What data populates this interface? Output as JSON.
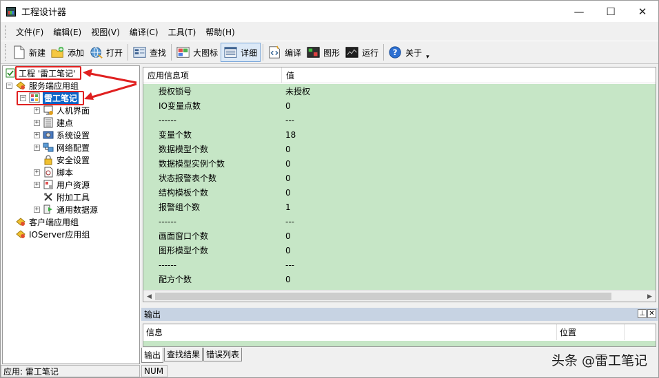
{
  "window": {
    "title": "工程设计器",
    "minimize": "—",
    "maximize": "☐",
    "close": "✕"
  },
  "menu": [
    "文件(F)",
    "编辑(E)",
    "视图(V)",
    "编译(C)",
    "工具(T)",
    "帮助(H)"
  ],
  "toolbar": {
    "new": "新建",
    "add": "添加",
    "open": "打开",
    "find": "查找",
    "large_icon": "大图标",
    "detail": "详细",
    "compile": "编译",
    "graphics": "图形",
    "run": "运行",
    "about": "关于",
    "more": "▾"
  },
  "tree": {
    "root": "工程 '雷工笔记'",
    "server_group": "服务端应用组",
    "app": "雷工笔记",
    "children": [
      "人机界面",
      "建点",
      "系统设置",
      "网络配置",
      "安全设置",
      "脚本",
      "用户资源",
      "附加工具",
      "通用数据源"
    ],
    "client_group": "客户端应用组",
    "ioserver_group": "IOServer应用组",
    "expand": "+",
    "collapse": "−"
  },
  "details": {
    "col1": "应用信息项",
    "col2": "值",
    "rows": [
      [
        "授权锁号",
        "未授权"
      ],
      [
        "IO变量点数",
        "0"
      ],
      [
        "------",
        "---"
      ],
      [
        "变量个数",
        "18"
      ],
      [
        "数据模型个数",
        "0"
      ],
      [
        "数据模型实例个数",
        "0"
      ],
      [
        "状态报警表个数",
        "0"
      ],
      [
        "结构模板个数",
        "0"
      ],
      [
        "报警组个数",
        "1"
      ],
      [
        "------",
        "---"
      ],
      [
        "画面窗口个数",
        "0"
      ],
      [
        "图形模型个数",
        "0"
      ],
      [
        "------",
        "---"
      ],
      [
        "配方个数",
        "0"
      ]
    ],
    "scroll_left": "◀",
    "scroll_right": "▶"
  },
  "output": {
    "title": "输出",
    "pin": "⊥",
    "close": "✕",
    "col_info": "信息",
    "col_pos": "位置",
    "tabs": [
      "输出",
      "查找结果",
      "错误列表"
    ]
  },
  "status": {
    "app": "应用: 雷工笔记",
    "num": "NUM"
  },
  "watermark": "头条 @雷工笔记",
  "colors": {
    "list_bg": "#c6e6c6",
    "selection": "#0a64c8",
    "annotation": "#e02020",
    "panel_title": "#c7d3e3"
  }
}
